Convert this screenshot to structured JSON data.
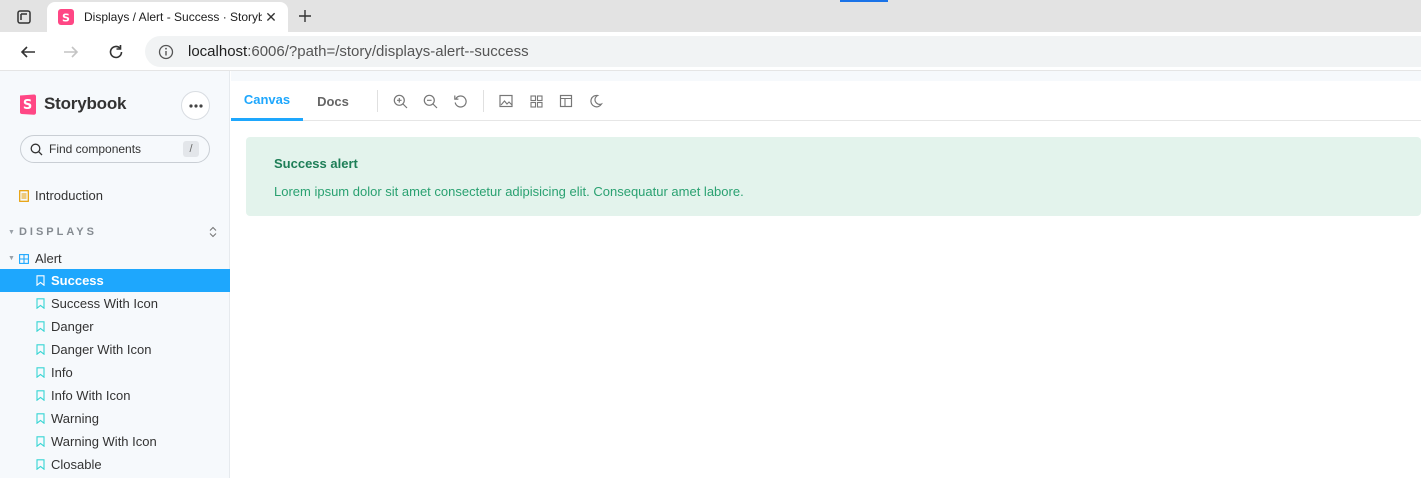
{
  "browser": {
    "tab_title": "Displays / Alert - Success · Storybook",
    "url_host": "localhost",
    "url_rest": ":6006/?path=/story/displays-alert--success"
  },
  "sidebar": {
    "brand": "Storybook",
    "search_placeholder": "Find components",
    "search_shortcut": "/",
    "intro": "Introduction",
    "section": "DISPLAYS",
    "component": "Alert",
    "stories": [
      {
        "label": "Success",
        "selected": true
      },
      {
        "label": "Success With Icon",
        "selected": false
      },
      {
        "label": "Danger",
        "selected": false
      },
      {
        "label": "Danger With Icon",
        "selected": false
      },
      {
        "label": "Info",
        "selected": false
      },
      {
        "label": "Info With Icon",
        "selected": false
      },
      {
        "label": "Warning",
        "selected": false
      },
      {
        "label": "Warning With Icon",
        "selected": false
      },
      {
        "label": "Closable",
        "selected": false
      }
    ]
  },
  "preview": {
    "tabs": [
      {
        "label": "Canvas",
        "active": true
      },
      {
        "label": "Docs",
        "active": false
      }
    ],
    "tools": [
      "zoom-in-icon",
      "zoom-out-icon",
      "reset-zoom-icon",
      "background-icon",
      "grid-icon",
      "viewport-icon",
      "dark-mode-icon"
    ]
  },
  "alert": {
    "title": "Success alert",
    "text": "Lorem ipsum dolor sit amet consectetur adipisicing elit. Consequatur amet labore."
  },
  "colors": {
    "accent": "#1ea7fd",
    "alert_bg": "#e3f3ec",
    "alert_title": "#1e7e57",
    "alert_text": "#2aa171"
  }
}
